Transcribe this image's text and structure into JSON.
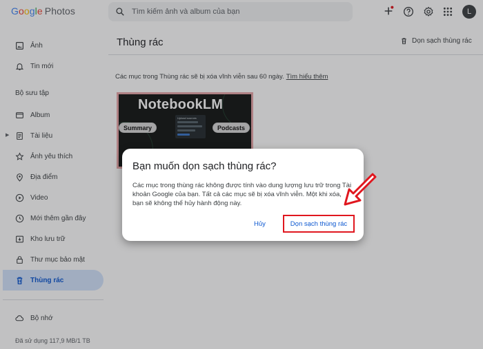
{
  "app": {
    "logo_google": [
      "G",
      "o",
      "o",
      "g",
      "l",
      "e"
    ],
    "logo_product": "Photos"
  },
  "search": {
    "placeholder": "Tìm kiếm ảnh và album của bạn"
  },
  "header": {
    "avatar_letter": "L",
    "icons": [
      "add-icon",
      "help-icon",
      "settings-icon",
      "apps-icon"
    ]
  },
  "sidebar": {
    "items_top": [
      {
        "label": "Ảnh",
        "icon": "photo-icon"
      },
      {
        "label": "Tin mới",
        "icon": "bell-icon"
      }
    ],
    "section_title": "Bộ sưu tập",
    "collections": [
      {
        "label": "Album",
        "icon": "album-icon"
      },
      {
        "label": "Tài liệu",
        "icon": "document-icon"
      },
      {
        "label": "Ảnh yêu thích",
        "icon": "star-icon"
      },
      {
        "label": "Địa điểm",
        "icon": "location-icon"
      },
      {
        "label": "Video",
        "icon": "video-icon"
      },
      {
        "label": "Mới thêm gần đây",
        "icon": "recent-icon"
      },
      {
        "label": "Kho lưu trữ",
        "icon": "archive-icon"
      },
      {
        "label": "Thư mục bảo mật",
        "icon": "lock-icon"
      },
      {
        "label": "Thùng rác",
        "icon": "trash-icon",
        "active": true
      }
    ],
    "storage_label": "Bộ nhớ",
    "storage_used": "Đã sử dụng 117,9 MB/1 TB"
  },
  "main": {
    "title": "Thùng rác",
    "empty_trash_button": "Dọn sạch thùng rác",
    "info_text": "Các mục trong Thùng rác sẽ bị xóa vĩnh viễn sau 60 ngày.",
    "learn_more": "Tìm hiểu thêm",
    "thumbnail": {
      "title": "NotebookLM",
      "pill_left": "Summary",
      "pill_right": "Podcasts",
      "panel_title": "Upload sources"
    }
  },
  "dialog": {
    "title": "Bạn muốn dọn sạch thùng rác?",
    "body": "Các mục trong thùng rác không được tính vào dung lượng lưu trữ trong Tài khoản Google của bạn. Tất cả các mục sẽ bị xóa vĩnh viễn. Một khi xóa, bạn sẽ không thể hủy hành động này.",
    "cancel": "Hủy",
    "confirm": "Dọn sạch thùng rác"
  },
  "colors": {
    "accent": "#0b57d0",
    "active_bg": "#d3e3fd",
    "annotation_red": "#e0161e"
  }
}
